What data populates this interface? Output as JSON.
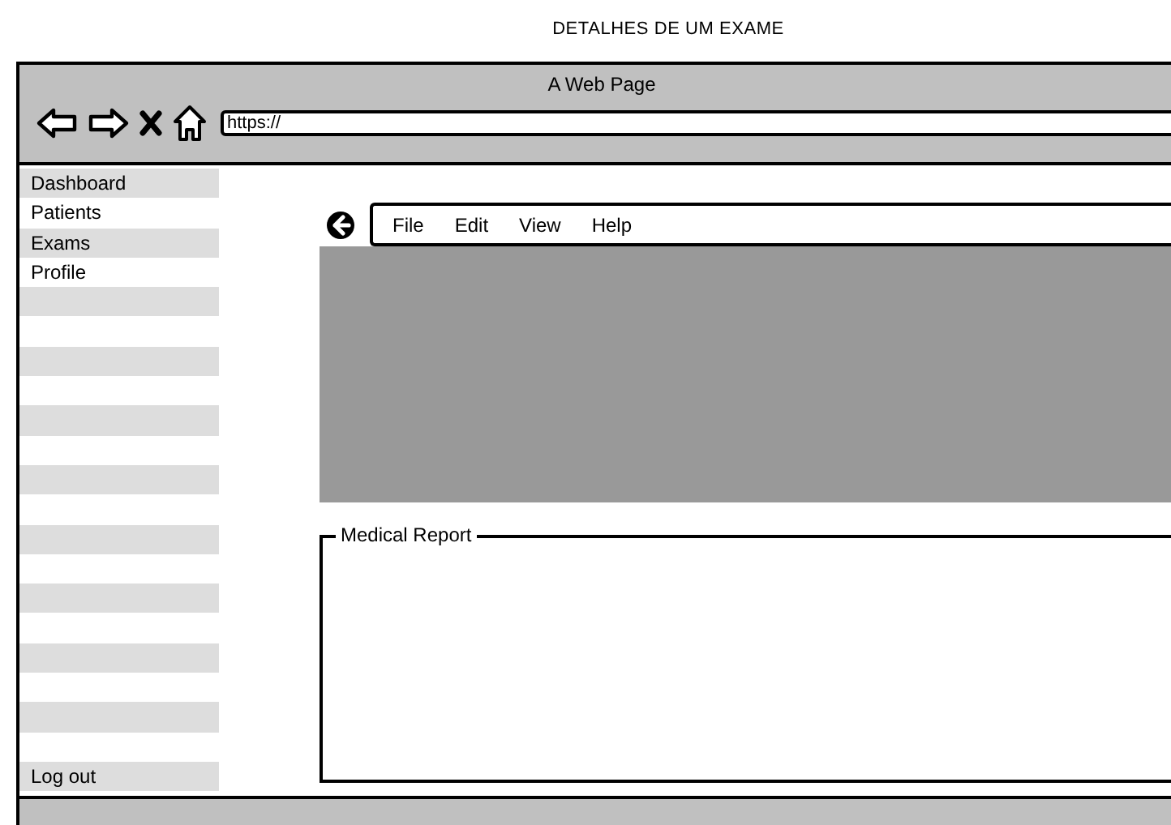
{
  "page_title": "DETALHES DE UM EXAME",
  "window": {
    "title": "A Web Page",
    "url": "https://"
  },
  "sidebar": {
    "items": [
      "Dashboard",
      "Patients",
      "Exams",
      "Profile"
    ],
    "footer_item": "Log out"
  },
  "menu_bar": {
    "items": [
      "File",
      "Edit",
      "View",
      "Help"
    ]
  },
  "report": {
    "legend": "Medical Report"
  }
}
